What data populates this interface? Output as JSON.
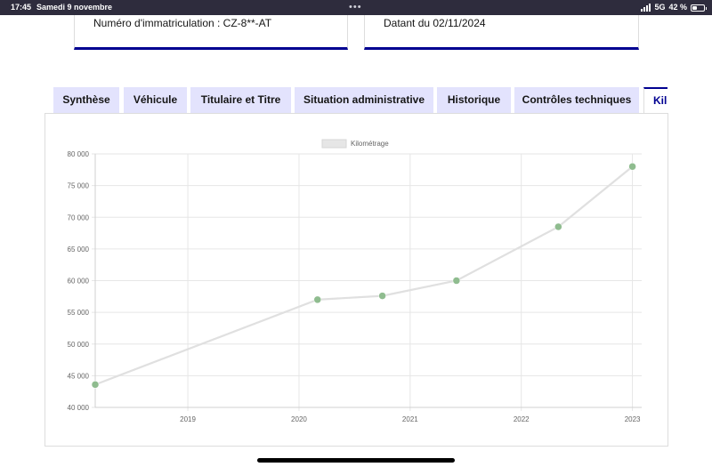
{
  "status_bar": {
    "time": "17:45",
    "date": "Samedi 9 novembre",
    "network": "5G",
    "battery": "42 %",
    "battery_level": 0.42,
    "icons": [
      "dots-icon",
      "signal-icon",
      "battery-icon"
    ]
  },
  "cards": [
    {
      "text": "Numéro d'immatriculation : CZ-8**-AT"
    },
    {
      "text": "Datant du 02/11/2024"
    }
  ],
  "tabs": [
    {
      "label": "Synthèse",
      "active": false
    },
    {
      "label": "Véhicule",
      "active": false
    },
    {
      "label": "Titulaire et Titre",
      "active": false
    },
    {
      "label": "Situation administrative",
      "active": false
    },
    {
      "label": "Historique",
      "active": false
    },
    {
      "label": "Contrôles techniques",
      "active": false
    },
    {
      "label": "Kilométrage",
      "active": true
    }
  ],
  "colors": {
    "tab_bg": "#e3e3fd",
    "accent": "#000091",
    "line": "#e0e0e0",
    "point": "#8fbc8f"
  },
  "chart_data": {
    "type": "line",
    "legend": [
      "Kilométrage"
    ],
    "legend_position": "top",
    "grid": true,
    "x_ticks": [
      "2019",
      "2020",
      "2021",
      "2022",
      "2023"
    ],
    "y_ticks": [
      "40 000",
      "45 000",
      "50 000",
      "55 000",
      "60 000",
      "65 000",
      "70 000",
      "75 000",
      "80 000"
    ],
    "xlim": [
      "2018-03",
      "2023-02"
    ],
    "ylim": [
      40000,
      80000
    ],
    "series": [
      {
        "name": "Kilométrage",
        "points": [
          {
            "x": "2018-03",
            "y": 43600
          },
          {
            "x": "2020-03",
            "y": 57000
          },
          {
            "x": "2020-10",
            "y": 57600
          },
          {
            "x": "2021-06",
            "y": 60000
          },
          {
            "x": "2022-05",
            "y": 68500
          },
          {
            "x": "2023-01",
            "y": 78000
          }
        ]
      }
    ]
  }
}
